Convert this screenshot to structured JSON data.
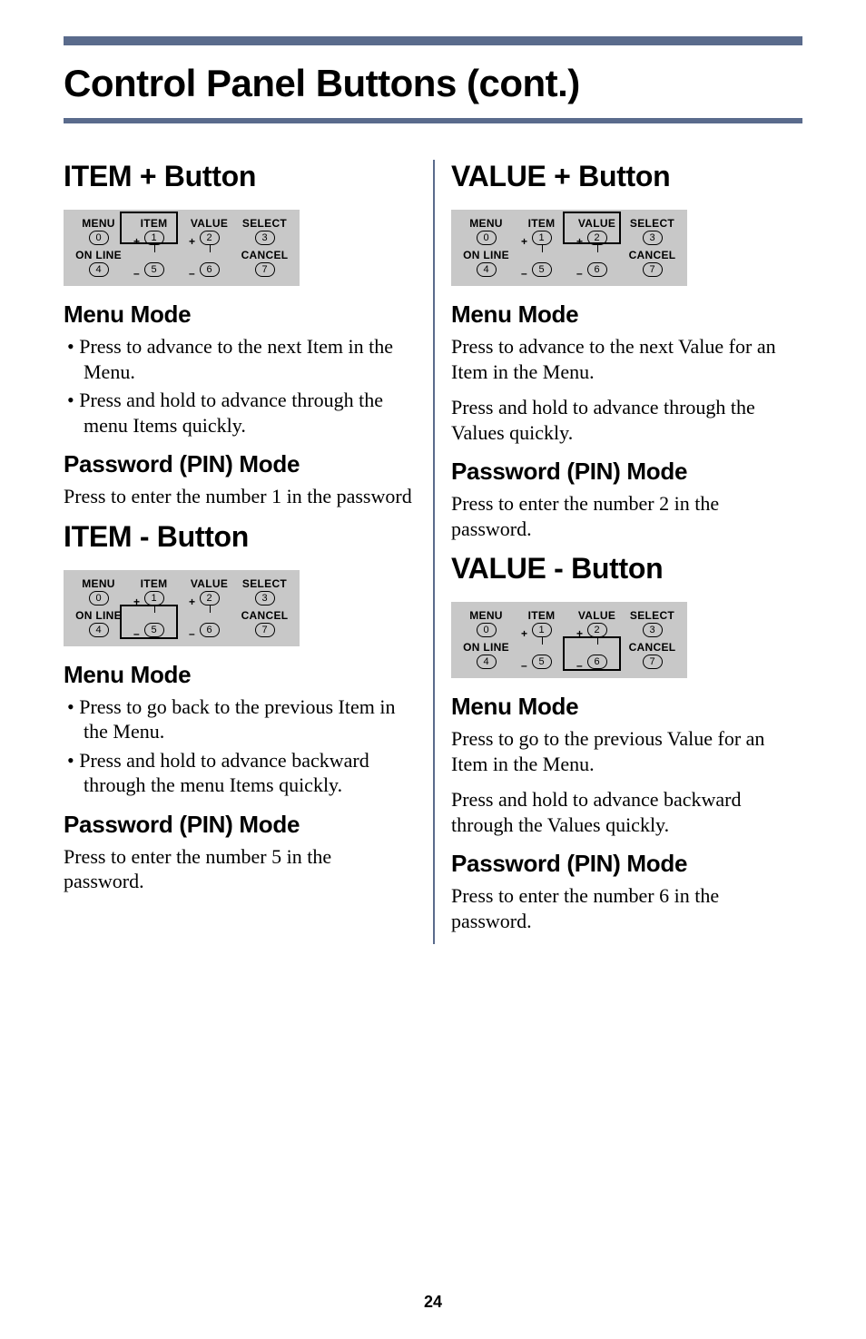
{
  "pageTitle": "Control Panel Buttons (cont.)",
  "panelLabels": {
    "top": [
      "MENU",
      "ITEM",
      "VALUE",
      "SELECT"
    ],
    "topNums": [
      "0",
      "1",
      "2",
      "3"
    ],
    "bot": [
      "ON LINE",
      "",
      "",
      "CANCEL"
    ],
    "botNums": [
      "4",
      "5",
      "6",
      "7"
    ]
  },
  "left": {
    "s1": {
      "title": "ITEM + Button",
      "h_menu": "Menu Mode",
      "menu_items": [
        "Press to advance to the next Item in the Menu.",
        "Press and hold to advance through the menu Items quickly."
      ],
      "h_pin": "Password (PIN) Mode",
      "pin_text": "Press to enter the number 1 in the password"
    },
    "s2": {
      "title": "ITEM - Button",
      "h_menu": "Menu Mode",
      "menu_items": [
        "Press to go back to the previous Item in the Menu.",
        "Press and hold to advance backward through the menu Items quickly."
      ],
      "h_pin": "Password (PIN) Mode",
      "pin_text": "Press to enter the number 5 in the password."
    }
  },
  "right": {
    "s1": {
      "title": "VALUE + Button",
      "h_menu": "Menu Mode",
      "menu_p1": "Press to advance to the next Value for an Item in the Menu.",
      "menu_p2": "Press and hold to advance through the Values quickly.",
      "h_pin": "Password (PIN) Mode",
      "pin_text": "Press to enter the number 2 in the password."
    },
    "s2": {
      "title": "VALUE - Button",
      "h_menu": "Menu Mode",
      "menu_p1": "Press to go to the previous Value for an Item in the Menu.",
      "menu_p2": "Press and hold to advance backward through the Values quickly.",
      "h_pin": "Password (PIN) Mode",
      "pin_text": "Press to enter the number 6 in the password."
    }
  },
  "pageNum": "24"
}
